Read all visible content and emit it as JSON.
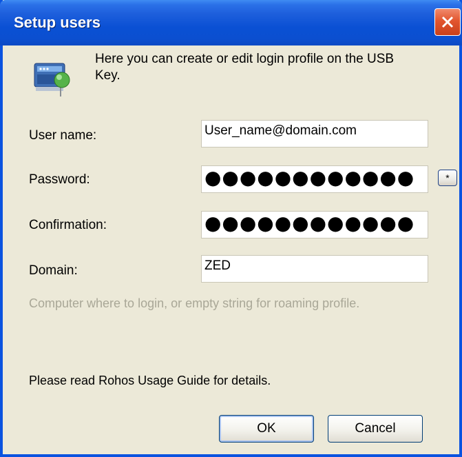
{
  "window": {
    "title": "Setup users"
  },
  "intro_text": "Here you can create or edit login profile on the USB Key.",
  "form": {
    "user_name_label": "User name:",
    "user_name_value": "User_name@domain.com",
    "password_label": "Password:",
    "password_value": "●●●●●●●●●●●●",
    "confirmation_label": "Confirmation:",
    "confirmation_value": "●●●●●●●●●●●●",
    "domain_label": "Domain:",
    "domain_value": "ZED",
    "reveal_button_label": "*"
  },
  "hint_text": "Computer where to login, or empty string for roaming profile.",
  "guide_text": "Please read  Rohos Usage Guide for details.",
  "buttons": {
    "ok_label": "OK",
    "cancel_label": "Cancel"
  },
  "icons": {
    "close": "close-icon",
    "app": "usb-key-user-icon"
  }
}
